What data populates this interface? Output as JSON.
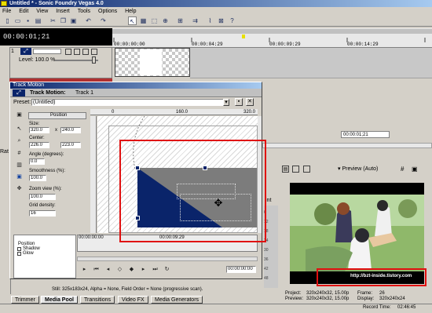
{
  "app": {
    "title": "Untitled * - Sonic Foundry Vegas 4.0"
  },
  "menu": [
    "File",
    "Edit",
    "View",
    "Insert",
    "Tools",
    "Options",
    "Help"
  ],
  "toolbar": {
    "icons": [
      "new-icon",
      "open-icon",
      "save-icon",
      "properties-icon",
      "cut-icon",
      "copy-icon",
      "paste-icon",
      "undo-icon",
      "redo-icon",
      "normal-edit-tool-icon",
      "envelope-tool-icon",
      "selection-tool-icon",
      "zoom-tool-icon",
      "snapping-icon",
      "auto-ripple-icon",
      "lock-envelopes-icon",
      "ignore-grouping-icon",
      "help-icon"
    ]
  },
  "timeline": {
    "time_display": "00:00:01;21",
    "ruler": [
      "00:00:00:00",
      "00:00:04:29",
      "00:00:09:29",
      "00:00:14:29"
    ]
  },
  "track1": {
    "number": "1",
    "level": "Level: 100.0 %"
  },
  "track_motion": {
    "title": "Track Motion",
    "track_label": "Track Motion:",
    "track_name": "Track 1",
    "preset_label": "Preset:",
    "preset_value": "(Untitled)",
    "section_label": "Position",
    "size_label": "Size:",
    "size_w": "320.0",
    "size_x": "x",
    "size_h": "240.0",
    "center_label": "Center:",
    "center_x": "226.0",
    "center_y": "223.0",
    "angle_label": "Angle (degrees):",
    "angle_value": "0.0",
    "smoothness_label": "Smoothness (%):",
    "smoothness_value": "100.0",
    "zoom_label": "Zoom view (%):",
    "zoom_value": "100.0",
    "grid_label": "Grid density:",
    "grid_value": "16",
    "ruler_marks": [
      "0",
      "160.0",
      "320.0"
    ],
    "keyframe_list": [
      "Position",
      "Shadow",
      "Glow"
    ],
    "kf_time_start": "00:00:00:00",
    "kf_time_mid": "00:00:09:29",
    "kf_time_end": "00:00:00:00"
  },
  "status": {
    "still_info": "Still: 325x183x24, Alpha = None, Field Order = None (progressive scan)."
  },
  "bottom_tabs": [
    "Trimmer",
    "Media Pool",
    "Transitions",
    "Video FX",
    "Media Generators"
  ],
  "right_panel": {
    "timecode": "00:00:01;21",
    "preview_label": "Preview (Auto)",
    "watermark": "http://bzt-inside.tistory.com",
    "project_label": "Project:",
    "project_value": "320x240x32, 15.00p",
    "preview_label2": "Preview:",
    "preview_value": "320x240x32, 15.00p",
    "frame_label": "Frame:",
    "frame_value": "26",
    "display_label": "Display:",
    "display_value": "320x240x24",
    "record_label": "Record Time:",
    "record_value": "02:46:45"
  },
  "left_fragment": "Rat",
  "mixer_fragment": "int"
}
